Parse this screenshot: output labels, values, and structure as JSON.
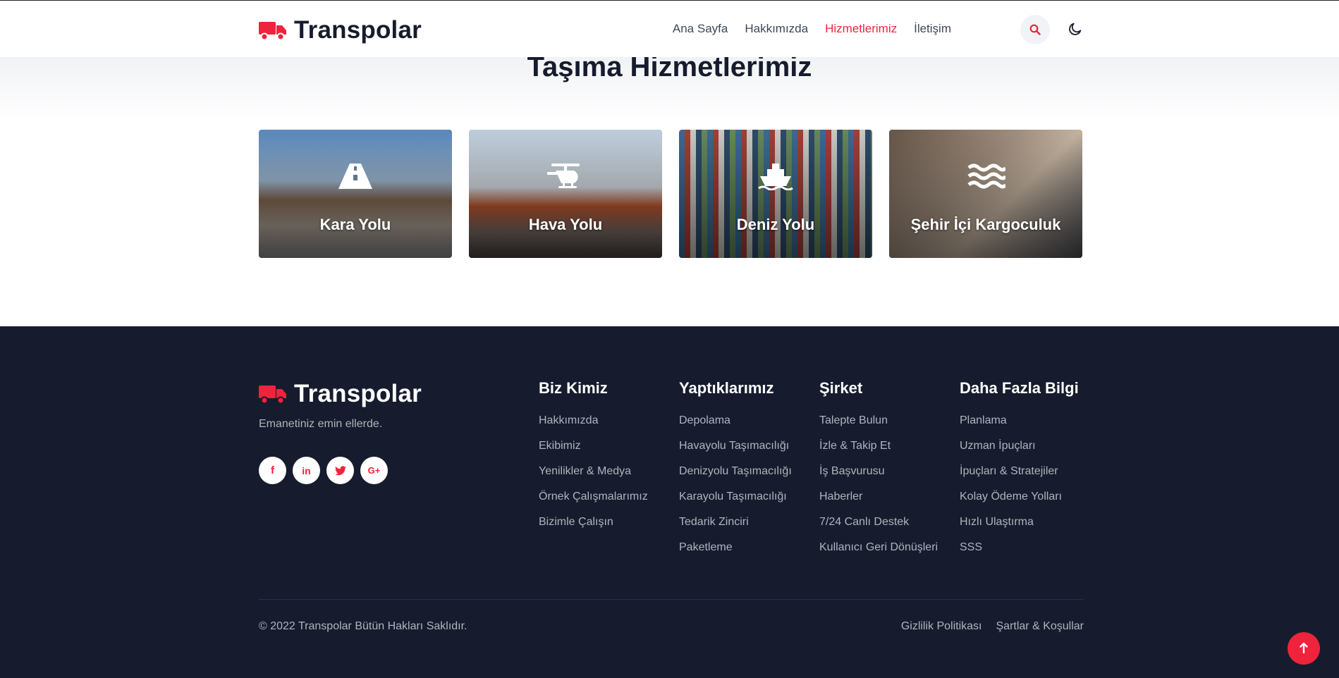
{
  "header": {
    "brand": "Transpolar",
    "nav": [
      {
        "label": "Ana Sayfa",
        "active": false
      },
      {
        "label": "Hakkımızda",
        "active": false
      },
      {
        "label": "Hizmetlerimiz",
        "active": true
      },
      {
        "label": "İletişim",
        "active": false
      }
    ],
    "icons": {
      "search": "search-icon",
      "theme": "moon-icon"
    }
  },
  "services": {
    "title": "Taşıma Hizmetlerimiz",
    "cards": [
      {
        "label": "Kara Yolu",
        "icon": "road-icon"
      },
      {
        "label": "Hava Yolu",
        "icon": "helicopter-icon"
      },
      {
        "label": "Deniz Yolu",
        "icon": "ship-icon"
      },
      {
        "label": "Şehir İçi Kargoculuk",
        "icon": "water-icon"
      }
    ]
  },
  "footer": {
    "brand": "Transpolar",
    "tagline": "Emanetiniz emin ellerde.",
    "socials": [
      {
        "name": "facebook-icon",
        "glyph": "f"
      },
      {
        "name": "linkedin-icon",
        "glyph": "in"
      },
      {
        "name": "twitter-icon",
        "glyph": ""
      },
      {
        "name": "google-plus-icon",
        "glyph": "G+"
      }
    ],
    "columns": [
      {
        "title": "Biz Kimiz",
        "links": [
          "Hakkımızda",
          "Ekibimiz",
          "Yenilikler & Medya",
          "Örnek Çalışmalarımız",
          "Bizimle Çalışın"
        ]
      },
      {
        "title": "Yaptıklarımız",
        "links": [
          "Depolama",
          "Havayolu Taşımacılığı",
          "Denizyolu Taşımacılığı",
          "Karayolu Taşımacılığı",
          "Tedarik Zinciri",
          "Paketleme"
        ]
      },
      {
        "title": "Şirket",
        "links": [
          "Talepte Bulun",
          "İzle & Takip Et",
          "İş Başvurusu",
          "Haberler",
          "7/24 Canlı Destek",
          "Kullanıcı Geri Dönüşleri"
        ]
      },
      {
        "title": "Daha Fazla Bilgi",
        "links": [
          "Planlama",
          "Uzman İpuçları",
          "İpuçları & Stratejiler",
          "Kolay Ödeme Yolları",
          "Hızlı Ulaştırma",
          "SSS"
        ]
      }
    ],
    "copyright": "© 2022 Transpolar Bütün Hakları Saklıdır.",
    "legal": [
      "Gizlilik Politikası",
      "Şartlar & Koşullar"
    ]
  },
  "colors": {
    "accent": "#ef233c",
    "footer_bg": "#161c2d",
    "text_dark": "#161c2d",
    "text_muted": "#adb5bd"
  }
}
